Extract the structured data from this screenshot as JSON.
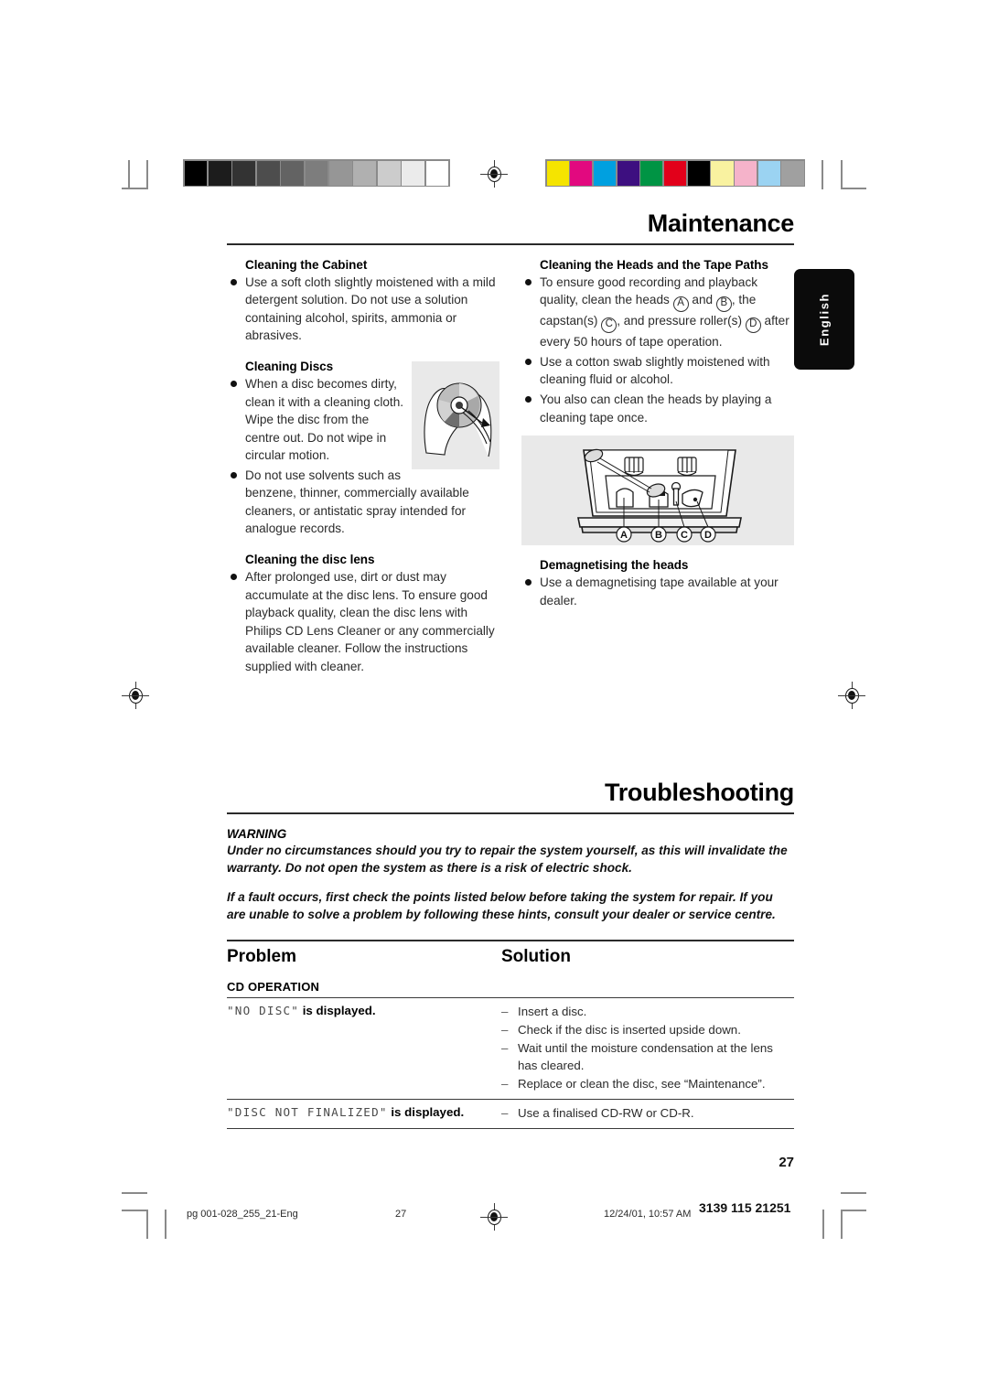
{
  "page": {
    "number": "27",
    "language_tab": "English"
  },
  "calibration": {
    "grayscale_label": "grayscale-step-wedge",
    "grayscale": [
      "#000000",
      "#1c1c1c",
      "#333333",
      "#4d4d4d",
      "#636363",
      "#7d7d7d",
      "#969696",
      "#b0b0b0",
      "#cccccc",
      "#ebebeb",
      "#ffffff"
    ],
    "color_label": "color-control-patches",
    "colors": [
      "#f5e400",
      "#e2097f",
      "#00a0e0",
      "#3d0f80",
      "#009444",
      "#e2001a",
      "#000000",
      "#f9f2a0",
      "#f5b3ca",
      "#9bd3f2",
      "#a0a0a0"
    ]
  },
  "maintenance": {
    "title": "Maintenance",
    "left_column": {
      "cabinet": {
        "heading": "Cleaning the Cabinet",
        "bullets": [
          "Use a soft cloth slightly moistened with a mild detergent solution. Do not use a solution containing alcohol, spirits, ammonia or abrasives."
        ]
      },
      "discs": {
        "heading": "Cleaning Discs",
        "bullets": [
          "When a disc becomes dirty, clean it with a cleaning cloth. Wipe the disc from the centre out.  Do not wipe in circular motion.",
          "Do not use solvents such as benzene, thinner, commercially available cleaners, or antistatic spray intended for analogue records."
        ],
        "figure": "disc-cleaning-illustration"
      },
      "lens": {
        "heading": "Cleaning the disc lens",
        "bullets": [
          "After prolonged use, dirt or dust may accumulate at the disc lens. To ensure good playback quality, clean the disc lens with Philips CD Lens Cleaner or any commercially available cleaner. Follow the instructions supplied with cleaner."
        ]
      }
    },
    "right_column": {
      "heads": {
        "heading": "Cleaning the Heads and the Tape Paths",
        "bullet1_parts": {
          "p1": "To ensure good recording and playback quality, clean the heads ",
          "a": "A",
          "p2": " and ",
          "b": "B",
          "p3": ", the capstan(s) ",
          "c": "C",
          "p4": ", and pressure roller(s) ",
          "d": "D",
          "p5": " after every 50 hours of tape operation."
        },
        "bullets": [
          "Use a cotton swab slightly moistened with cleaning fluid or alcohol.",
          "You also can clean the heads by playing a cleaning tape once."
        ],
        "figure": "tape-deck-head-diagram",
        "figure_labels": [
          "A",
          "B",
          "C",
          "D"
        ]
      },
      "demagnetising": {
        "heading": "Demagnetising the heads",
        "bullets": [
          "Use a demagnetising tape available at your dealer."
        ]
      }
    }
  },
  "troubleshooting": {
    "title": "Troubleshooting",
    "warning_label": "WARNING",
    "warning_text": "Under no circumstances should you try to repair the system yourself, as this will invalidate the warranty.  Do not open the system as there is a risk of electric shock.",
    "intro_text": "If a fault occurs, first check the points listed below before taking the system for repair. If you are unable to solve a problem by following these hints, consult your dealer or service centre.",
    "columns": {
      "problem": "Problem",
      "solution": "Solution"
    },
    "group_heading": "CD OPERATION",
    "rows": [
      {
        "problem_lcd": "\"NO DISC\"",
        "problem_rest": " is displayed.",
        "solutions": [
          "Insert a disc.",
          "Check if the disc is inserted upside down.",
          "Wait until the moisture condensation at the lens has cleared.",
          "Replace or clean the disc, see “Maintenance”."
        ]
      },
      {
        "problem_lcd": "\"DISC NOT FINALIZED\"",
        "problem_rest": " is displayed.",
        "solutions": [
          "Use a finalised CD-RW or CD-R."
        ]
      }
    ]
  },
  "footer": {
    "file_name": "pg 001-028_255_21-Eng",
    "page_number": "27",
    "timestamp": "12/24/01, 10:57 AM",
    "doc_code": "3139 115 21251"
  }
}
